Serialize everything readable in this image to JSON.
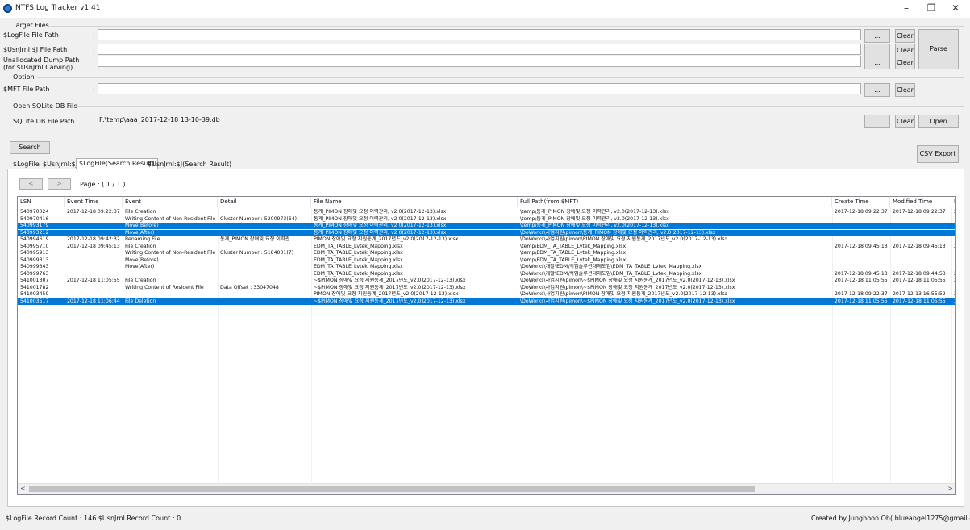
{
  "window": {
    "title": "NTFS Log Tracker v1.41",
    "minimize": "–",
    "maximize": "❐",
    "close": "✕"
  },
  "target_files": {
    "group_title": "Target Files",
    "logfile_label": "$LogFile File Path",
    "usnjrnl_label": "$UsnJrnl:$J File Path",
    "unalloc_label_1": "Unallocated Dump Path",
    "unalloc_label_2": "(for $UsnJrnl Carving)",
    "colon": ":",
    "logfile_value": "",
    "usnjrnl_value": "",
    "unalloc_value": ""
  },
  "option": {
    "group_title": "Option",
    "mft_label": "$MFT File Path",
    "mft_value": ""
  },
  "sqlite": {
    "group_title": "Open SQLite DB File",
    "label": "SQLite DB File Path",
    "value": "F:\\temp\\aaa_2017-12-18 13-10-39.db"
  },
  "buttons": {
    "browse": "...",
    "clear": "Clear",
    "parse": "Parse",
    "open": "Open",
    "search": "Search",
    "csv_export": "CSV Export"
  },
  "tabs": [
    "$LogFile",
    "$UsnJrnl:$J",
    "$LogFile(Search Result)",
    "$UsnJrnl:$J(Search Result)"
  ],
  "pager": {
    "prev": "<",
    "next": ">",
    "page": "Page : ( 1 / 1 )"
  },
  "columns": [
    "LSN",
    "Event Time",
    "Event",
    "Detail",
    "File Name",
    "Full Path(from $MFT)",
    "Create Time",
    "Modified Time",
    "M"
  ],
  "rows": [
    {
      "lsn": "540970024",
      "time": "2017-12-18 09:22:37",
      "event": "File Creation",
      "detail": "",
      "name": "통계_PIMON 장애및 요청 이력관리, v2.0(2017-12-13).xlsx",
      "path": "\\temp\\통계_PIMON 장애및 요청 이력관리, v2.0(2017-12-13).xlsx",
      "create": "2017-12-18 09:22:37",
      "modified": "2017-12-18 09:22:37",
      "m": "2",
      "sel": false
    },
    {
      "lsn": "540970416",
      "time": "",
      "event": "Writing Content of Non-Resident File",
      "detail": "Cluster Number : 5200973(64)",
      "name": "통계_PIMON 장애및 요청 이력관리, v2.0(2017-12-13).xlsx",
      "path": "\\temp\\통계_PIMON 장애및 요청 이력관리, v2.0(2017-12-13).xlsx",
      "create": "",
      "modified": "",
      "m": "",
      "sel": false
    },
    {
      "lsn": "540993179",
      "time": "",
      "event": "Move(Before)",
      "detail": "",
      "name": "통계_PIMON 장애및 요청 이력관리, v2.0(2017-12-13).xlsx",
      "path": "\\temp\\통계_PIMON 장애및 요청 이력관리, v2.0(2017-12-13).xlsx",
      "create": "",
      "modified": "",
      "m": "",
      "sel": true
    },
    {
      "lsn": "540993212",
      "time": "",
      "event": "Move(After)",
      "detail": "",
      "name": "통계_PIMON 장애및 요청 이력관리, v2.0(2017-12-13).xlsx",
      "path": "\\DoWorks\\사업지원\\pimon\\통계_PIMON 장애및 요청 이력관리, v2.0(2017-12-13).xlsx",
      "create": "",
      "modified": "",
      "m": "",
      "sel": true
    },
    {
      "lsn": "540994619",
      "time": "2017-12-18 09:42:32",
      "event": "Renaming File",
      "detail": "통계_PIMON 장애및 요청 이력관...",
      "name": "PIMON 장애및 요청 지원통계_2017년도_v2.0(2017-12-13).xlsx",
      "path": "\\DoWorks\\사업지원\\pimon\\PIMON 장애및 요청 지원통계_2017년도_v2.0(2017-12-13).xlsx",
      "create": "",
      "modified": "",
      "m": "",
      "sel": false
    },
    {
      "lsn": "540995710",
      "time": "2017-12-18 09:45:13",
      "event": "File Creation",
      "detail": "",
      "name": "EDM_TA_TABLE_Lvtek_Mapping.xlsx",
      "path": "\\temp\\EDM_TA_TABLE_Lvtek_Mapping.xlsx",
      "create": "2017-12-18 09:45:13",
      "modified": "2017-12-18 09:45:13",
      "m": "2",
      "sel": false
    },
    {
      "lsn": "540995913",
      "time": "",
      "event": "Writing Content of Non-Resident File",
      "detail": "Cluster Number : 5184001(7)",
      "name": "EDM_TA_TABLE_Lvtek_Mapping.xlsx",
      "path": "\\temp\\EDM_TA_TABLE_Lvtek_Mapping.xlsx",
      "create": "",
      "modified": "",
      "m": "",
      "sel": false
    },
    {
      "lsn": "540999313",
      "time": "",
      "event": "Move(Before)",
      "detail": "",
      "name": "EDM_TA_TABLE_Lvtek_Mapping.xlsx",
      "path": "\\temp\\EDM_TA_TABLE_Lvtek_Mapping.xlsx",
      "create": "",
      "modified": "",
      "m": "",
      "sel": false
    },
    {
      "lsn": "540999343",
      "time": "",
      "event": "Move(After)",
      "detail": "",
      "name": "EDM_TA_TABLE_Lvtek_Mapping.xlsx",
      "path": "\\DoWorks\\개발\\EDM\\백업솔루션대체도입\\EDM_TA_TABLE_Lvtek_Mapping.xlsx",
      "create": "",
      "modified": "",
      "m": "",
      "sel": false
    },
    {
      "lsn": "540999763",
      "time": "",
      "event": "",
      "detail": "",
      "name": "EDM_TA_TABLE_Lvtek_Mapping.xlsx",
      "path": "\\DoWorks\\개발\\EDM\\백업솔루션대체도입\\EDM_TA_TABLE_Lvtek_Mapping.xlsx",
      "create": "2017-12-18 09:45:13",
      "modified": "2017-12-18 09:44:53",
      "m": "2",
      "sel": false
    },
    {
      "lsn": "541001307",
      "time": "2017-12-18 11:05:55",
      "event": "File Creation",
      "detail": "",
      "name": "~$PIMON 장애및 요청 지원통계_2017년도_v2.0(2017-12-13).xlsx",
      "path": "\\DoWorks\\사업지원\\pimon\\~$PIMON 장애및 요청 지원통계_2017년도_v2.0(2017-12-13).xlsx",
      "create": "2017-12-18 11:05:55",
      "modified": "2017-12-18 11:05:55",
      "m": "2",
      "sel": false
    },
    {
      "lsn": "541001782",
      "time": "",
      "event": "Writing Content of Resident File",
      "detail": "Data Offset : 33047048",
      "name": "~$PIMON 장애및 요청 지원통계_2017년도_v2.0(2017-12-13).xlsx",
      "path": "\\DoWorks\\사업지원\\pimon\\~$PIMON 장애및 요청 지원통계_2017년도_v2.0(2017-12-13).xlsx",
      "create": "",
      "modified": "",
      "m": "",
      "sel": false
    },
    {
      "lsn": "541003459",
      "time": "",
      "event": "",
      "detail": "",
      "name": "PIMON 장애및 요청 지원통계_2017년도_v2.0(2017-12-13).xlsx",
      "path": "\\DoWorks\\사업지원\\pimon\\PIMON 장애및 요청 지원통계_2017년도_v2.0(2017-12-13).xlsx",
      "create": "2017-12-18 09:22:37",
      "modified": "2017-12-13 16:55:52",
      "m": "2",
      "sel": false
    },
    {
      "lsn": "541003517",
      "time": "2017-12-18 11:06:44",
      "event": "File Deletion",
      "detail": "",
      "name": "~$PIMON 장애및 요청 지원통계_2017년도_v2.0(2017-12-13).xlsx",
      "path": "\\DoWorks\\사업지원\\pimon\\~$PIMON 장애및 요청 지원통계_2017년도_v2.0(2017-12-13).xlsx",
      "create": "2017-12-18 11:05:55",
      "modified": "2017-12-18 11:05:55",
      "m": "2",
      "sel": true
    }
  ],
  "scroll": {
    "left": "<",
    "right": ">"
  },
  "status": {
    "counts": "$LogFile Record Count : 146  $UsnJrnl Record Count : 0",
    "credit": "Created by Junghoon Oh( blueangel1275@gmail.com )"
  },
  "colors": {
    "selection": "#0078d7",
    "accent": "#2d7ad6"
  }
}
